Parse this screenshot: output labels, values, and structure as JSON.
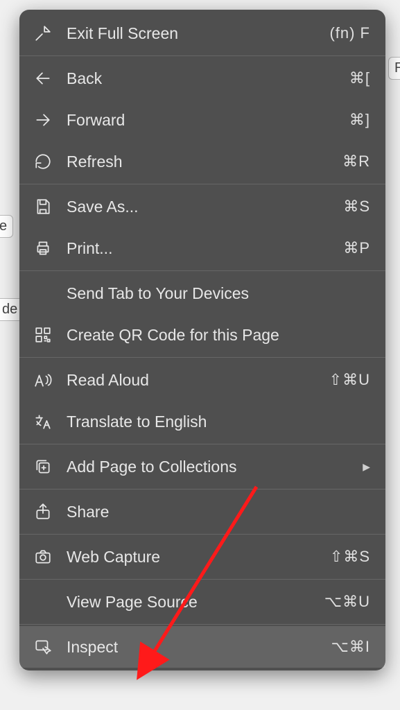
{
  "menu": {
    "exit_full_screen": {
      "label": "Exit Full Screen",
      "shortcut": "(fn) F"
    },
    "back": {
      "label": "Back",
      "shortcut": "⌘["
    },
    "forward": {
      "label": "Forward",
      "shortcut": "⌘]"
    },
    "refresh": {
      "label": "Refresh",
      "shortcut": "⌘R"
    },
    "save_as": {
      "label": "Save As...",
      "shortcut": "⌘S"
    },
    "print": {
      "label": "Print...",
      "shortcut": "⌘P"
    },
    "send_tab": {
      "label": "Send Tab to Your Devices"
    },
    "create_qr": {
      "label": "Create QR Code for this Page"
    },
    "read_aloud": {
      "label": "Read Aloud",
      "shortcut": "⇧⌘U"
    },
    "translate": {
      "label": "Translate to English"
    },
    "add_collections": {
      "label": "Add Page to Collections"
    },
    "share": {
      "label": "Share"
    },
    "web_capture": {
      "label": "Web Capture",
      "shortcut": "⇧⌘S"
    },
    "view_source": {
      "label": "View Page Source",
      "shortcut": "⌥⌘U"
    },
    "inspect": {
      "label": "Inspect",
      "shortcut": "⌥⌘I"
    }
  },
  "background": {
    "frag1": "RI",
    "frag2": "e",
    "frag3": "de"
  }
}
